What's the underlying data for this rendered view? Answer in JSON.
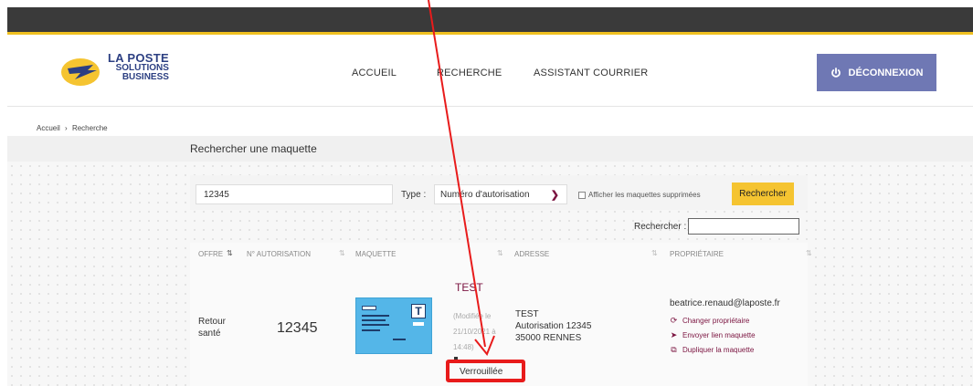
{
  "header": {
    "logo": {
      "line1": "LA POSTE",
      "line2": "SOLUTIONS",
      "line3": "BUSINESS"
    },
    "nav": [
      "ACCUEIL",
      "RECHERCHE",
      "ASSISTANT COURRIER"
    ],
    "logout_label": "DÉCONNEXION",
    "logout_color": "#6f78b4",
    "accent_color": "#f0c020"
  },
  "breadcrumb": {
    "home": "Accueil",
    "sep": "›",
    "current": "Recherche"
  },
  "page_title": "Rechercher une maquette",
  "search": {
    "value": "12345",
    "type_label": "Type :",
    "type_value": "Numéro d'autorisation",
    "checkbox_label": "Afficher les maquettes supprimées",
    "button": "Rechercher",
    "filter_label": "Rechercher :"
  },
  "table": {
    "headers": [
      "OFFRE",
      "N° AUTORISATION",
      "MAQUETTE",
      "ADRESSE",
      "PROPRIÉTAIRE"
    ],
    "row": {
      "offre_line1": "Retour",
      "offre_line2": "santé",
      "autorisation": "12345",
      "maquette_title": "TEST",
      "maquette_mod1": "(Modifiée le",
      "maquette_mod2": "21/10/2021 à",
      "maquette_mod3": "14:48)",
      "maquette_status": "Verrouillée",
      "adresse_line1": "TEST",
      "adresse_line2": "Autorisation 12345",
      "adresse_line3": "35000 RENNES",
      "owner_email": "beatrice.renaud@laposte.fr",
      "owner_actions": [
        "Changer propriétaire",
        "Envoyer lien maquette",
        "Dupliquer la maquette"
      ]
    }
  },
  "colors": {
    "link": "#7b1440",
    "highlight": "#e81b1b",
    "button": "#f5c431"
  }
}
